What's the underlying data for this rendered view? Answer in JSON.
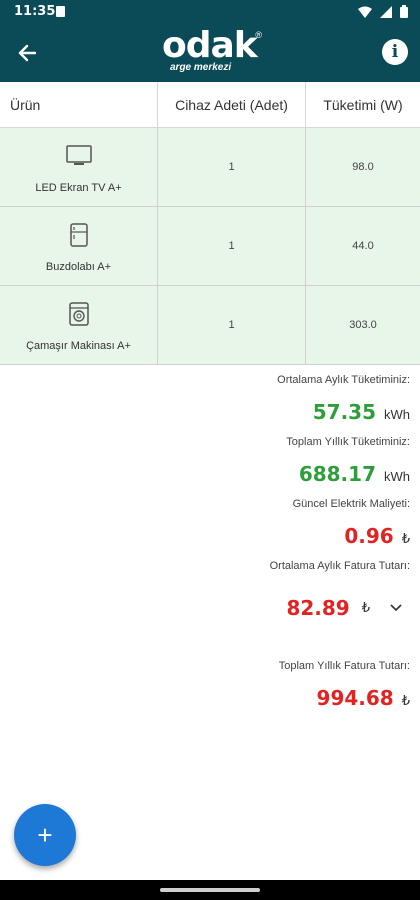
{
  "status_bar": {
    "time": "11:35"
  },
  "app_bar": {
    "logo_word": "odak",
    "logo_reg": "®",
    "logo_sub": "arge merkezi",
    "info_label": "i"
  },
  "table": {
    "headers": [
      "Ürün",
      "Cihaz Adeti (Adet)",
      "Tüketimi (W)"
    ],
    "rows": [
      {
        "icon": "tv-icon",
        "name": "LED Ekran TV A+",
        "count": "1",
        "consumption": "98.0"
      },
      {
        "icon": "fridge-icon",
        "name": "Buzdolabı A+",
        "count": "1",
        "consumption": "44.0"
      },
      {
        "icon": "washing-machine-icon",
        "name": "Çamaşır Makinası A+",
        "count": "1",
        "consumption": "303.0"
      }
    ]
  },
  "stats": {
    "monthly_label": "Ortalama Aylık Tüketiminiz:",
    "monthly_value": "57.35",
    "monthly_unit": "kWh",
    "yearly_label": "Toplam Yıllık Tüketiminiz:",
    "yearly_value": "688.17",
    "yearly_unit": "kWh",
    "cost_label": "Güncel Elektrik Maliyeti:",
    "cost_value": "0.96",
    "cost_unit": "₺",
    "monthly_bill_label": "Ortalama Aylık Fatura Tutarı:",
    "monthly_bill_value": "82.89",
    "monthly_bill_unit": "₺",
    "yearly_bill_label": "Toplam Yıllık Fatura Tutarı:",
    "yearly_bill_value": "994.68",
    "yearly_bill_unit": "₺"
  },
  "fab": {
    "label": "+"
  },
  "colors": {
    "app_bar": "#0b4a57",
    "row_bg": "#e8f5e9",
    "green_value": "#2e9e3a",
    "red_value": "#e32222",
    "fab": "#1e78d6"
  }
}
